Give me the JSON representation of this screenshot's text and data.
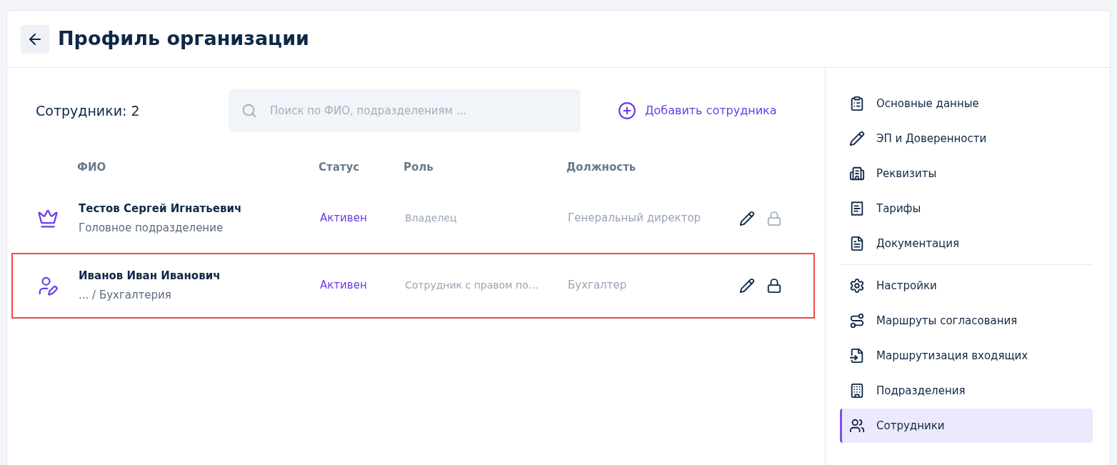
{
  "header": {
    "title": "Профиль организации"
  },
  "toolbar": {
    "count_label": "Сотрудники: 2",
    "search": {
      "placeholder": "Поиск по ФИО, подразделениям ..."
    },
    "add_button": "Добавить сотрудника"
  },
  "table": {
    "columns": [
      "ФИО",
      "Статус",
      "Роль",
      "Должность"
    ],
    "rows": [
      {
        "kind": "owner",
        "name": "Тестов Сергей Игнатьевич",
        "department": "Головное подразделение",
        "status": "Активен",
        "role": "Владелец",
        "position": "Генеральный директор",
        "lock_disabled": true,
        "highlighted": false
      },
      {
        "kind": "employee",
        "name": "Иванов Иван Иванович",
        "department": "... / Бухгалтерия",
        "status": "Активен",
        "role": "Сотрудник с правом по…",
        "position": "Бухгалтер",
        "lock_disabled": false,
        "highlighted": true
      }
    ]
  },
  "sidebar": {
    "sections": [
      {
        "items": [
          {
            "label": "Основные данные",
            "selected": false
          },
          {
            "label": "ЭП и Доверенности",
            "selected": false
          },
          {
            "label": "Реквизиты",
            "selected": false
          },
          {
            "label": "Тарифы",
            "selected": false
          },
          {
            "label": "Документация",
            "selected": false
          }
        ]
      },
      {
        "items": [
          {
            "label": "Настройки",
            "selected": false
          },
          {
            "label": "Маршруты согласования",
            "selected": false
          },
          {
            "label": "Маршрутизация входящих",
            "selected": false
          },
          {
            "label": "Подразделения",
            "selected": false
          },
          {
            "label": "Сотрудники",
            "selected": true
          }
        ]
      }
    ]
  }
}
